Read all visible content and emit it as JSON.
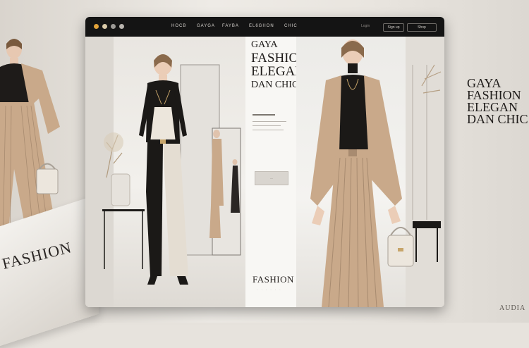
{
  "window": {
    "nav": [
      "HOCB",
      "GAYGA",
      "FAYBA",
      "EL6GIION",
      "CHIC"
    ],
    "buttons": [
      "Sign up",
      "Shop"
    ],
    "link": "Login"
  },
  "hero": {
    "headline": [
      "GAYA",
      "FASHION",
      "ELEGAN",
      "DAN CHIC"
    ],
    "fashion_label": "FASHION"
  },
  "background": {
    "right_title": [
      "GAYA",
      "FASHION",
      "ELEGAN",
      "DAN CHIC"
    ],
    "magazine_text": "FASHION",
    "corner_text": "AUDIA"
  },
  "colors": {
    "titlebar": "#141414",
    "dot_orange": "#e2a33a",
    "dot_beige": "#d9c9a8",
    "dot_gray": "#9c9a96",
    "accent_beige": "#c9a98a",
    "dark": "#1b1917"
  }
}
